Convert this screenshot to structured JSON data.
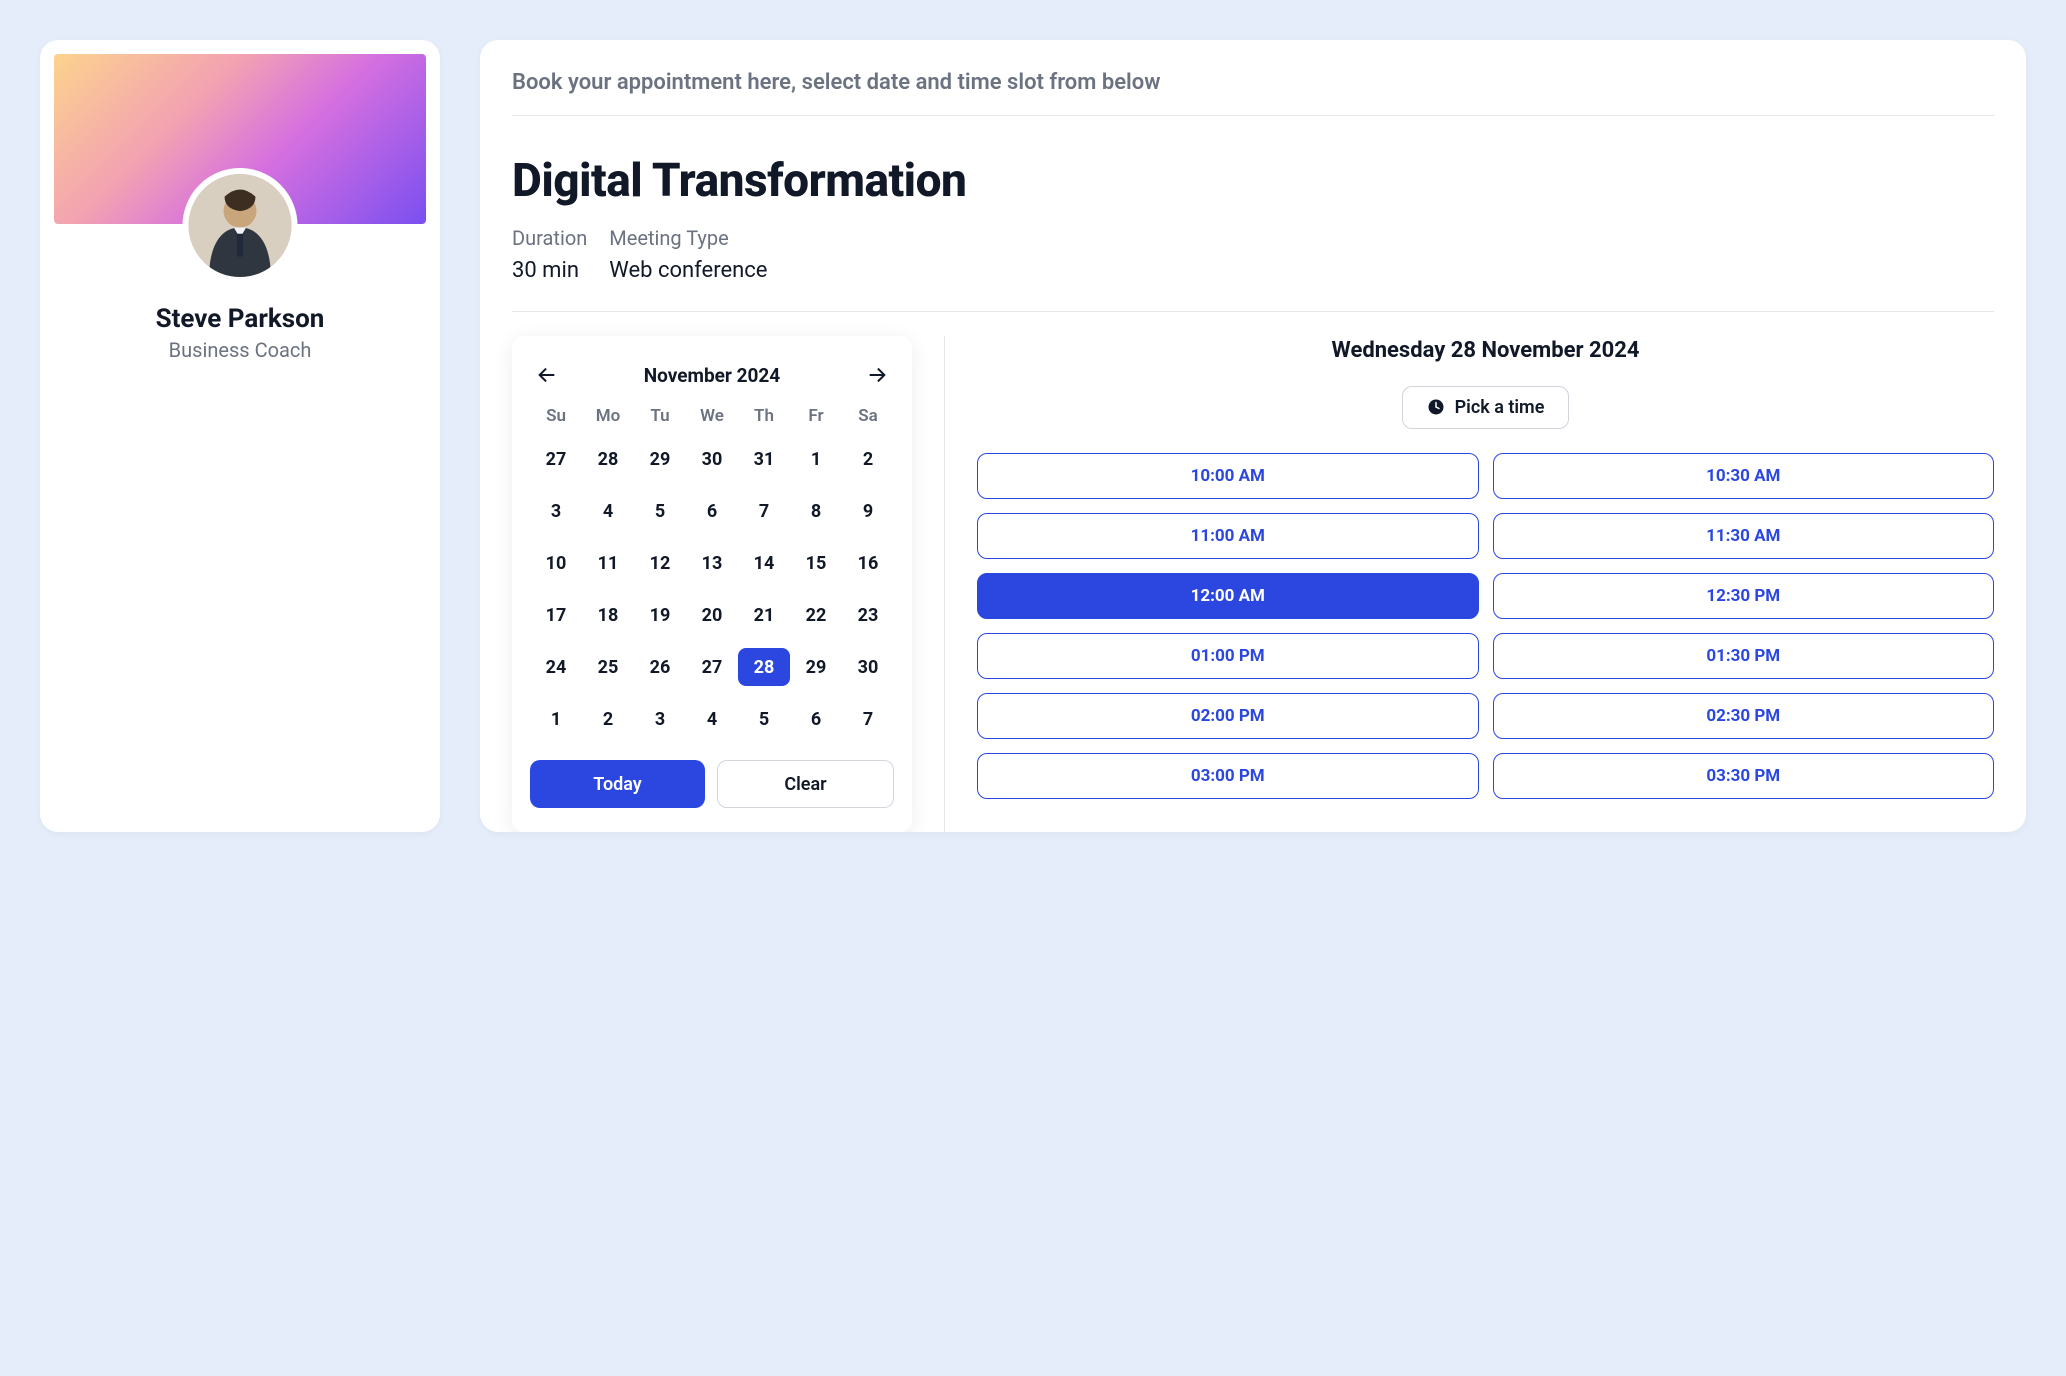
{
  "profile": {
    "name": "Steve Parkson",
    "role": "Business Coach"
  },
  "instruction": "Book your appointment here, select date and time slot from below",
  "service": {
    "title": "Digital Transformation",
    "duration_label": "Duration",
    "duration_value": "30 min",
    "meeting_type_label": "Meeting Type",
    "meeting_type_value": "Web conference"
  },
  "calendar": {
    "month_label": "November 2024",
    "dow": [
      "Su",
      "Mo",
      "Tu",
      "We",
      "Th",
      "Fr",
      "Sa"
    ],
    "weeks": [
      [
        "27",
        "28",
        "29",
        "30",
        "31",
        "1",
        "2"
      ],
      [
        "3",
        "4",
        "5",
        "6",
        "7",
        "8",
        "9"
      ],
      [
        "10",
        "11",
        "12",
        "13",
        "14",
        "15",
        "16"
      ],
      [
        "17",
        "18",
        "19",
        "20",
        "21",
        "22",
        "23"
      ],
      [
        "24",
        "25",
        "26",
        "27",
        "28",
        "29",
        "30"
      ],
      [
        "1",
        "2",
        "3",
        "4",
        "5",
        "6",
        "7"
      ]
    ],
    "selected_row": 4,
    "selected_col": 4,
    "today_label": "Today",
    "clear_label": "Clear"
  },
  "slots": {
    "date_label": "Wednesday 28 November 2024",
    "pick_label": "Pick a time",
    "times": [
      "10:00 AM",
      "10:30 AM",
      "11:00 AM",
      "11:30 AM",
      "12:00 AM",
      "12:30 PM",
      "01:00 PM",
      "01:30 PM",
      "02:00 PM",
      "02:30 PM",
      "03:00 PM",
      "03:30 PM"
    ],
    "selected_index": 4
  }
}
